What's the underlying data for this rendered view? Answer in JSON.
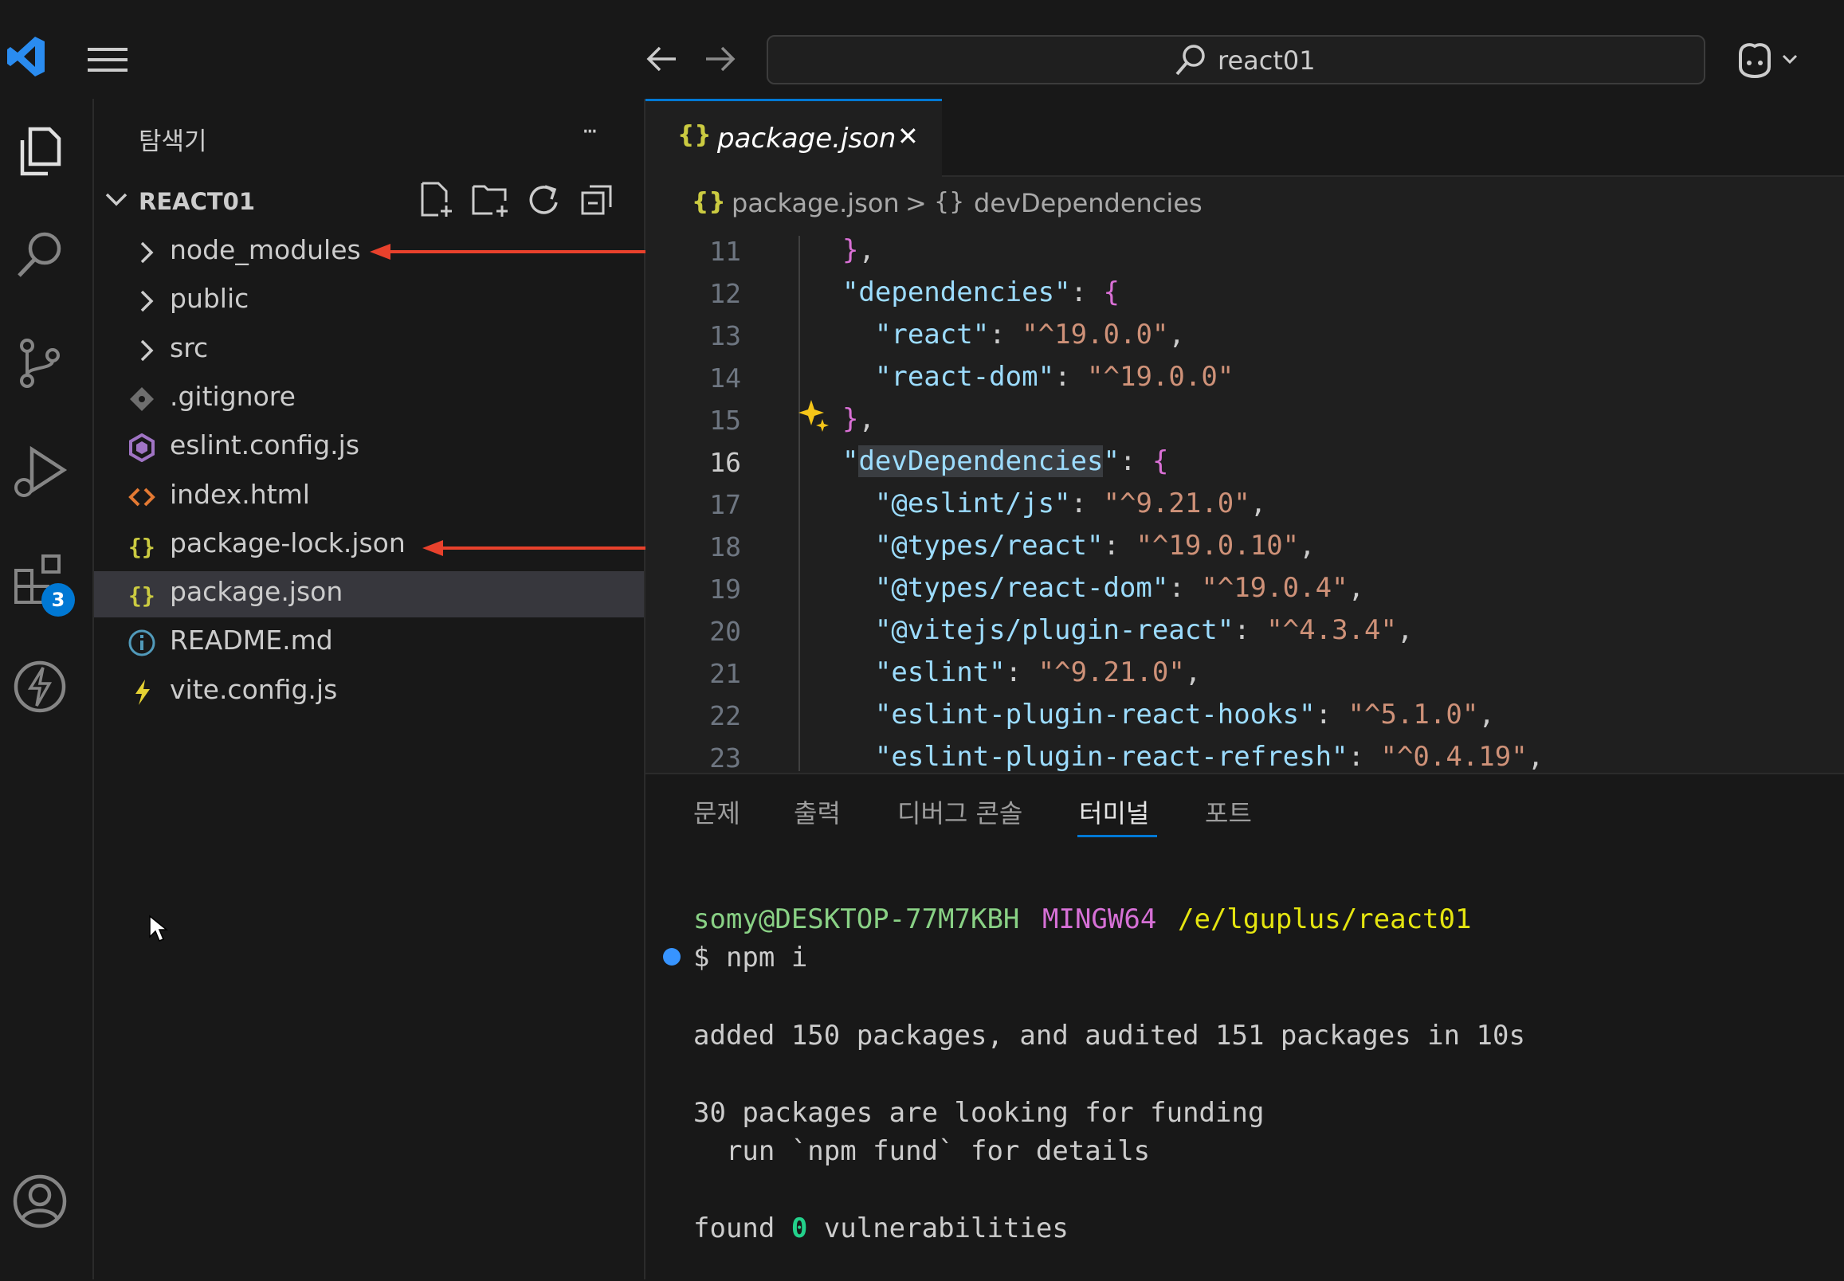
{
  "titlebar": {
    "search_text": "react01"
  },
  "activity": {
    "extensions_badge": "3"
  },
  "sidebar": {
    "title": "탐색기",
    "more": "···",
    "project_name": "REACT01",
    "items": [
      {
        "label": "node_modules",
        "kind": "folder",
        "icon": "chevron-right-icon"
      },
      {
        "label": "public",
        "kind": "folder",
        "icon": "chevron-right-icon"
      },
      {
        "label": "src",
        "kind": "folder",
        "icon": "chevron-right-icon"
      },
      {
        "label": ".gitignore",
        "kind": "file",
        "icon": "git-icon"
      },
      {
        "label": "eslint.config.js",
        "kind": "file",
        "icon": "eslint-icon"
      },
      {
        "label": "index.html",
        "kind": "file",
        "icon": "html-icon"
      },
      {
        "label": "package-lock.json",
        "kind": "file",
        "icon": "json-icon"
      },
      {
        "label": "package.json",
        "kind": "file",
        "icon": "json-icon",
        "selected": true
      },
      {
        "label": "README.md",
        "kind": "file",
        "icon": "info-icon"
      },
      {
        "label": "vite.config.js",
        "kind": "file",
        "icon": "vite-icon"
      }
    ]
  },
  "editor": {
    "tab": {
      "icon_text": "{}",
      "label": "package.json",
      "close": "✕"
    },
    "breadcrumb": {
      "file": "package.json",
      "separator": ">",
      "symbol_icon": "{}",
      "symbol": "devDependencies"
    },
    "lines": [
      {
        "n": "11",
        "text": "  },",
        "active": false
      },
      {
        "n": "12",
        "text": "  \"dependencies\": {",
        "active": false
      },
      {
        "n": "13",
        "text": "    \"react\": \"^19.0.0\",",
        "active": false
      },
      {
        "n": "14",
        "text": "    \"react-dom\": \"^19.0.0\"",
        "active": false
      },
      {
        "n": "15",
        "text": "  },",
        "active": false
      },
      {
        "n": "16",
        "text": "  \"devDependencies\": {",
        "active": true
      },
      {
        "n": "17",
        "text": "    \"@eslint/js\": \"^9.21.0\",",
        "active": false
      },
      {
        "n": "18",
        "text": "    \"@types/react\": \"^19.0.10\",",
        "active": false
      },
      {
        "n": "19",
        "text": "    \"@types/react-dom\": \"^19.0.4\",",
        "active": false
      },
      {
        "n": "20",
        "text": "    \"@vitejs/plugin-react\": \"^4.3.4\",",
        "active": false
      },
      {
        "n": "21",
        "text": "    \"eslint\": \"^9.21.0\",",
        "active": false
      },
      {
        "n": "22",
        "text": "    \"eslint-plugin-react-hooks\": \"^5.1.0\",",
        "active": false
      },
      {
        "n": "23",
        "text": "    \"eslint-plugin-react-refresh\": \"^0.4.19\",",
        "active": false
      }
    ]
  },
  "panel": {
    "tabs": [
      {
        "label": "문제",
        "active": false
      },
      {
        "label": "출력",
        "active": false
      },
      {
        "label": "디버그 콘솔",
        "active": false
      },
      {
        "label": "터미널",
        "active": true
      },
      {
        "label": "포트",
        "active": false
      }
    ],
    "terminal": {
      "user": "somy@DESKTOP-77M7KBH",
      "env": "MINGW64",
      "path": "/e/lguplus/react01",
      "prompt": "$ npm i",
      "out1": "added 150 packages, and audited 151 packages in 10s",
      "out2": "30 packages are looking for funding",
      "out3": "  run `npm fund` for details",
      "out4_pre": "found ",
      "out4_num": "0",
      "out4_post": " vulnerabilities"
    }
  },
  "colors": {
    "accent": "#0078d4",
    "arrow": "#e8412c",
    "json_icon": "#cbcb41",
    "selection": "#37373d"
  }
}
